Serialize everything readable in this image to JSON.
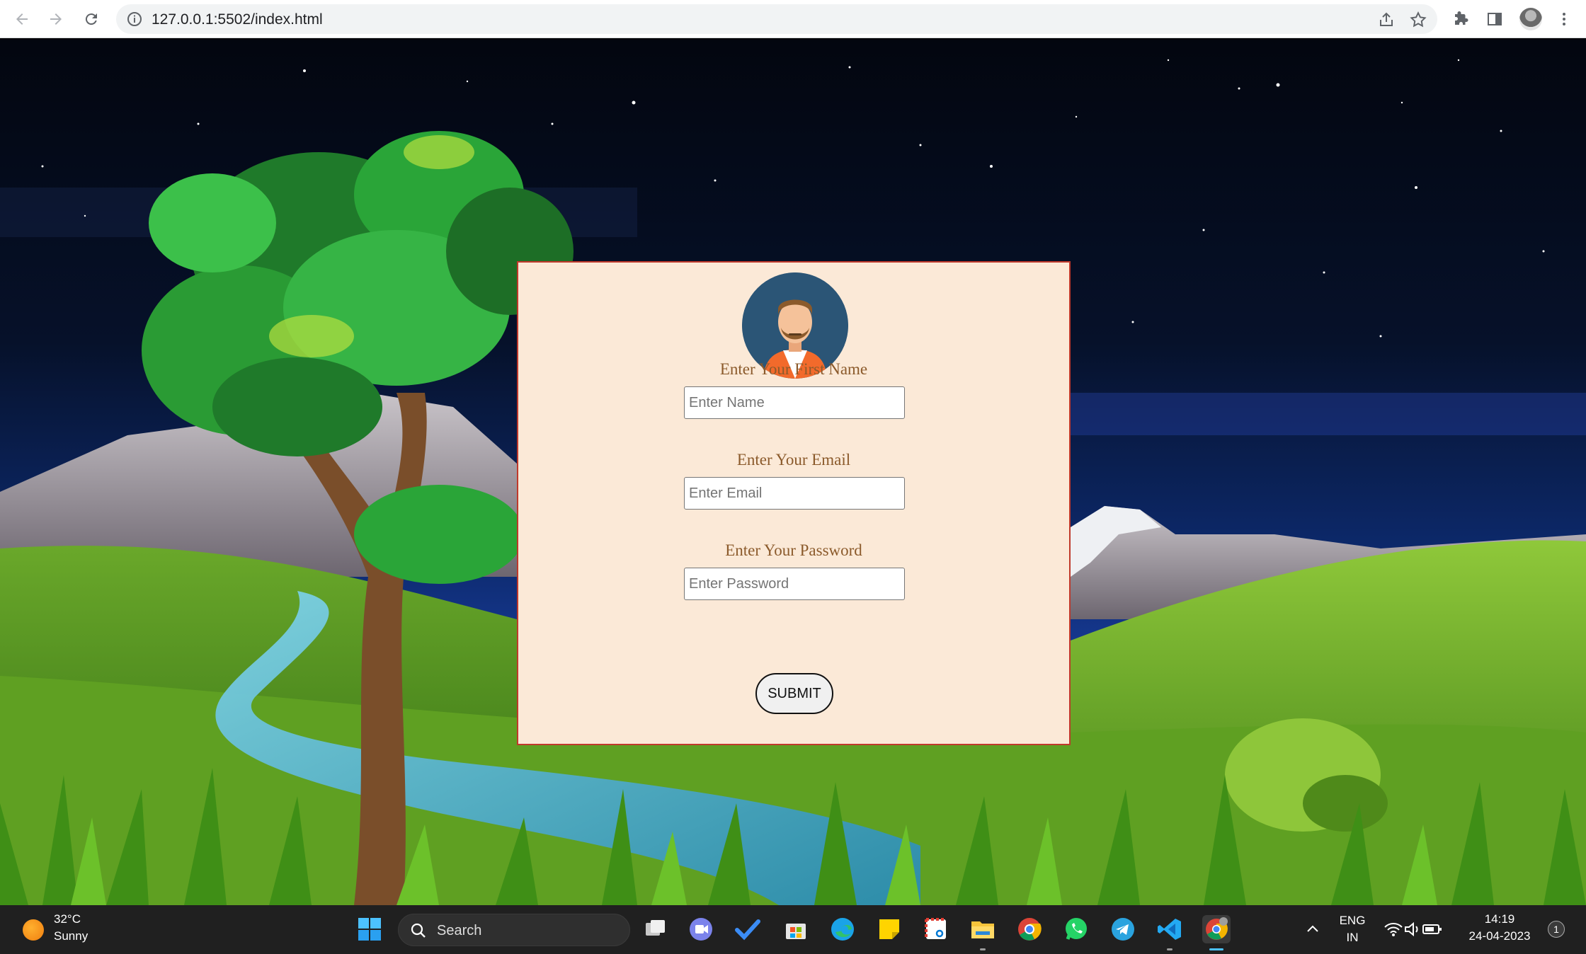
{
  "browser": {
    "url": "127.0.0.1:5502/index.html",
    "back_icon": "arrow-left-icon",
    "forward_icon": "arrow-right-icon",
    "reload_icon": "reload-icon"
  },
  "form": {
    "first_name_label": "Enter Your First Name",
    "first_name_placeholder": "Enter Name",
    "email_label": "Enter Your Email",
    "email_placeholder": "Enter Email",
    "password_label": "Enter Your Password",
    "password_placeholder": "Enter Password",
    "submit_label": "SUBMIT",
    "card_border_color": "#c0392b",
    "card_background": "#fbe9d7",
    "label_color": "#8b5a2b"
  },
  "taskbar": {
    "weather_temp": "32°C",
    "weather_desc": "Sunny",
    "search_label": "Search",
    "language_line1": "ENG",
    "language_line2": "IN",
    "time": "14:19",
    "date": "24-04-2023",
    "notification_count": "1",
    "pinned_apps": [
      "task-view",
      "teams",
      "todo",
      "store",
      "edge",
      "sticky-notes",
      "snipping-tool",
      "file-explorer",
      "chrome",
      "whatsapp",
      "telegram",
      "vscode",
      "chrome-active"
    ]
  }
}
